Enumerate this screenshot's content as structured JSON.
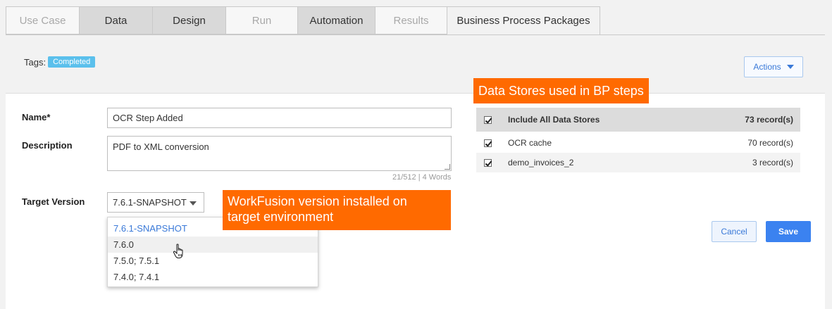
{
  "tabs": [
    {
      "label": "Use Case",
      "state": "disabled"
    },
    {
      "label": "Data",
      "state": "dark"
    },
    {
      "label": "Design",
      "state": "dark"
    },
    {
      "label": "Run",
      "state": "disabled"
    },
    {
      "label": "Automation",
      "state": "dark"
    },
    {
      "label": "Results",
      "state": "disabled"
    },
    {
      "label": "Business Process Packages",
      "state": "active"
    }
  ],
  "tags": {
    "label": "Tags:",
    "badge": "Completed"
  },
  "actions": {
    "label": "Actions"
  },
  "form": {
    "name_label": "Name*",
    "name_value": "OCR Step Added",
    "description_label": "Description",
    "description_value": "PDF to XML conversion",
    "counter": "21/512 | 4 Words",
    "target_label": "Target Version",
    "target_value": "7.6.1-SNAPSHOT",
    "options": [
      "7.6.1-SNAPSHOT",
      "7.6.0",
      "7.5.0; 7.5.1",
      "7.4.0; 7.4.1"
    ]
  },
  "callouts": {
    "data_stores": "Data Stores used in BP steps",
    "version_line1": "WorkFusion version installed on",
    "version_line2": "target environment"
  },
  "data_stores": {
    "header_label": "Include All Data Stores",
    "header_count": "73 record(s)",
    "rows": [
      {
        "name": "OCR cache",
        "count": "70 record(s)"
      },
      {
        "name": "demo_invoices_2",
        "count": "3 record(s)"
      }
    ]
  },
  "buttons": {
    "cancel": "Cancel",
    "save": "Save"
  },
  "colors": {
    "accent": "#3b82f0",
    "callout": "#ff6a00",
    "badge": "#5bc0ec"
  }
}
